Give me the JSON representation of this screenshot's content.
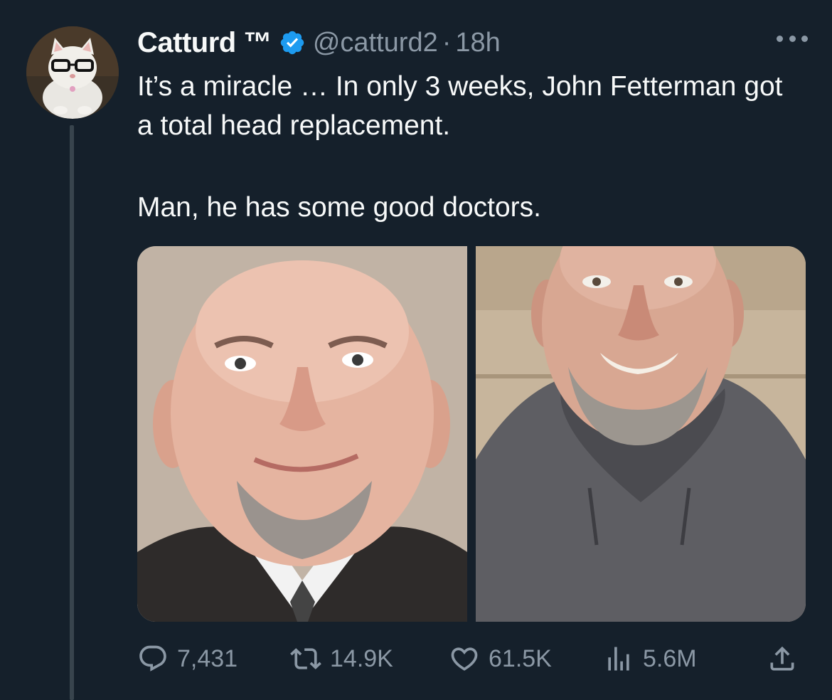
{
  "tweet": {
    "display_name": "Catturd ™",
    "handle": "@catturd2",
    "separator": "·",
    "time": "18h",
    "text_line1": "It’s a miracle … In only 3 weeks, John Fetterman got a total head replacement.",
    "text_line2": "Man, he has some good doctors."
  },
  "media": {
    "photos": [
      {
        "icon": "portrait-photo",
        "subject": "bald man in suit and tie"
      },
      {
        "icon": "portrait-photo",
        "subject": "bald man in grey hoodie"
      }
    ]
  },
  "actions": {
    "replies": "7,431",
    "retweets": "14.9K",
    "likes": "61.5K",
    "views": "5.6M"
  },
  "icons": {
    "verified": "verified-badge-icon",
    "more": "more-icon",
    "reply": "reply-icon",
    "retweet": "retweet-icon",
    "like": "heart-icon",
    "views": "views-icon",
    "share": "share-icon"
  },
  "colors": {
    "background": "#15202b",
    "text": "#f7f9f9",
    "muted": "#8b98a5",
    "verified": "#1d9bf0",
    "thread_line": "#38444d"
  }
}
